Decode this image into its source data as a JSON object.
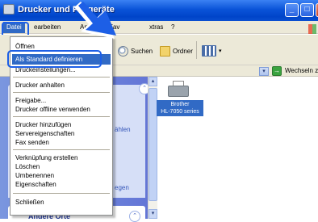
{
  "window": {
    "title": "Drucker und Faxgeräte"
  },
  "menubar": {
    "items": [
      "Datei",
      "earbeiten",
      "Ansicht",
      "Fav",
      "xtras",
      "?"
    ]
  },
  "toolbar": {
    "search_label": "Suchen",
    "folder_label": "Ordner"
  },
  "addressbar": {
    "go_label": "Wechseln z"
  },
  "file_menu": {
    "items": [
      {
        "label": "Öffnen"
      },
      {
        "label": "Als Standard definieren",
        "selected": true
      },
      {
        "label": "Druckeinstellungen..."
      },
      {
        "label": "Drucker anhalten"
      },
      {
        "label": "Freigabe..."
      },
      {
        "label": "Drucker offline verwenden"
      },
      {
        "label": "Drucker hinzufügen"
      },
      {
        "label": "Servereigenschaften"
      },
      {
        "label": "Fax senden"
      },
      {
        "label": "Verknüpfung erstellen"
      },
      {
        "label": "Löschen"
      },
      {
        "label": "Umbenennen"
      },
      {
        "label": "Eigenschaften"
      },
      {
        "label": "Schließen"
      }
    ]
  },
  "taskpane": {
    "fragment_1": "ählen",
    "fragment_2": "egen",
    "other_places": "Andere Orte"
  },
  "printer": {
    "label_line1": "Brother",
    "label_line2": "HL-7050 series"
  },
  "colors": {
    "title_bar": "#0a53d8",
    "menu_selection": "#316ac5",
    "callout": "#1d5fe6"
  }
}
